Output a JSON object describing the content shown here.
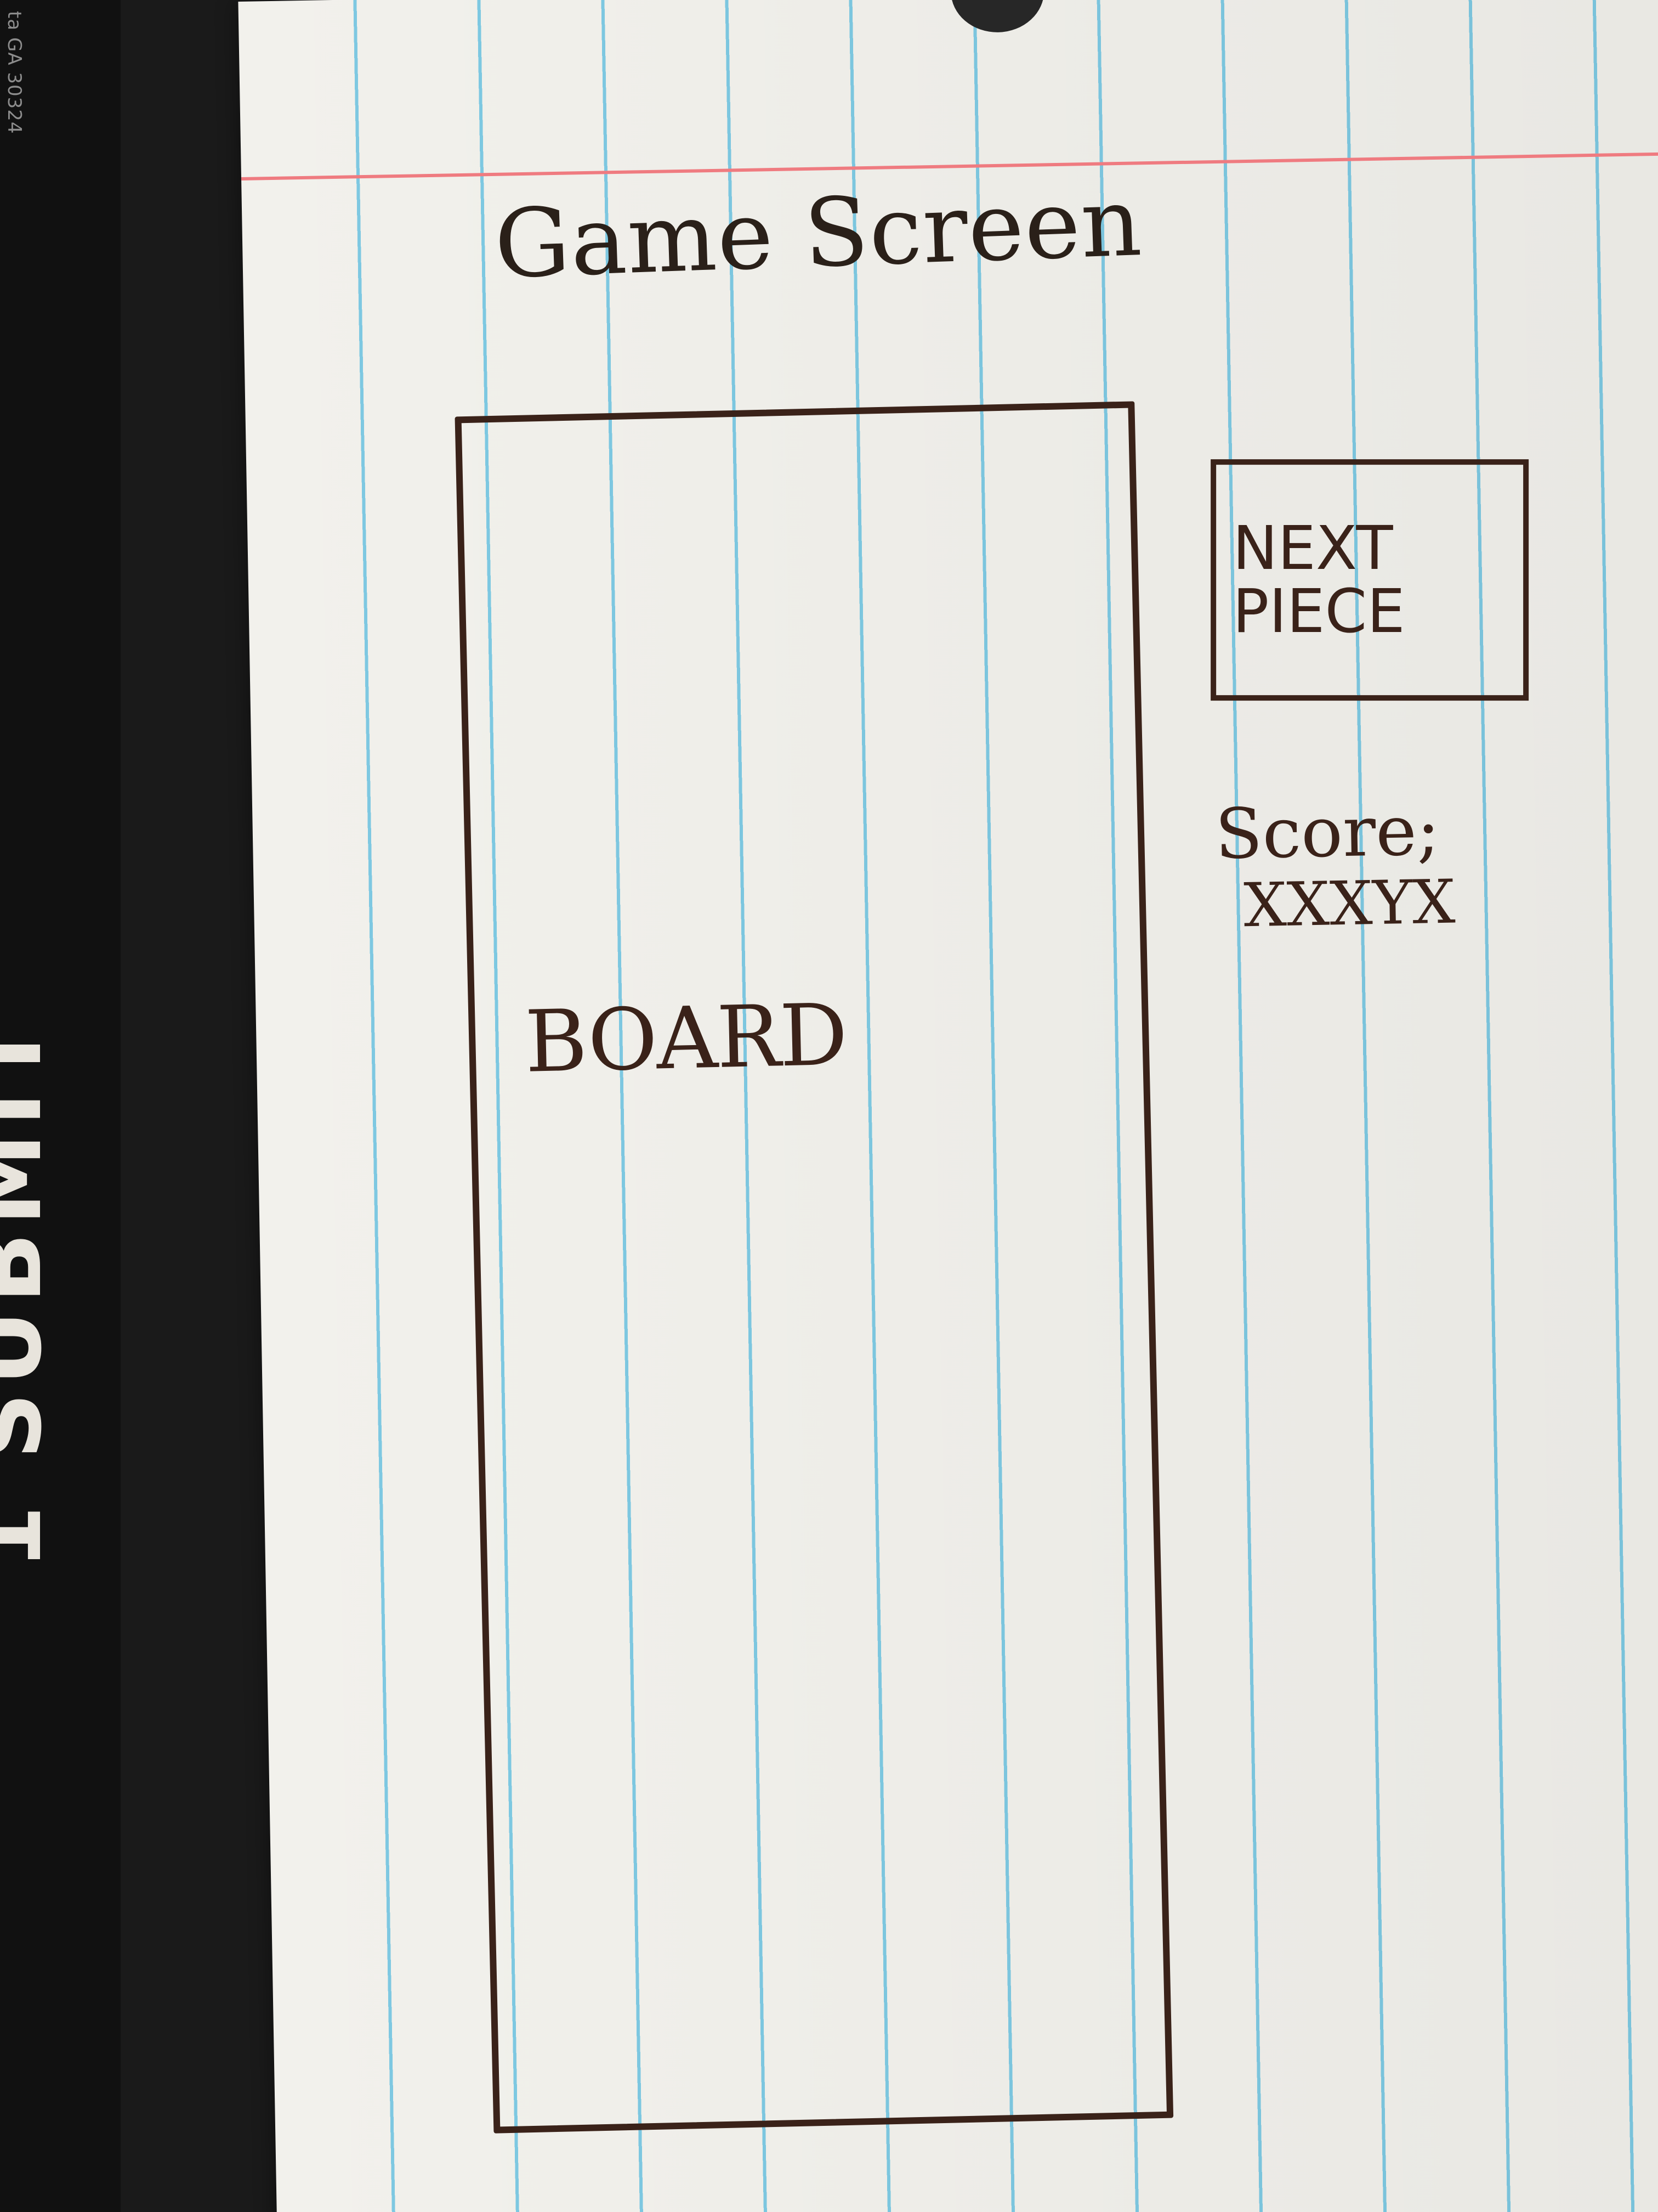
{
  "page": {
    "title": "Game Screen"
  },
  "board": {
    "label": "BOARD"
  },
  "next_piece": {
    "label": "NEXT\nPIECE"
  },
  "score": {
    "label": "Score;",
    "value": "XXXYX"
  },
  "edge": {
    "print_text": "ta GA 30324",
    "brand_text": "1 SUBMIT"
  },
  "colors": {
    "ink": "#3a2219",
    "paper": "#f2f1ec",
    "rule_blue": "#7ec9e2",
    "margin_red": "#ef7b80",
    "background": "#151515"
  }
}
